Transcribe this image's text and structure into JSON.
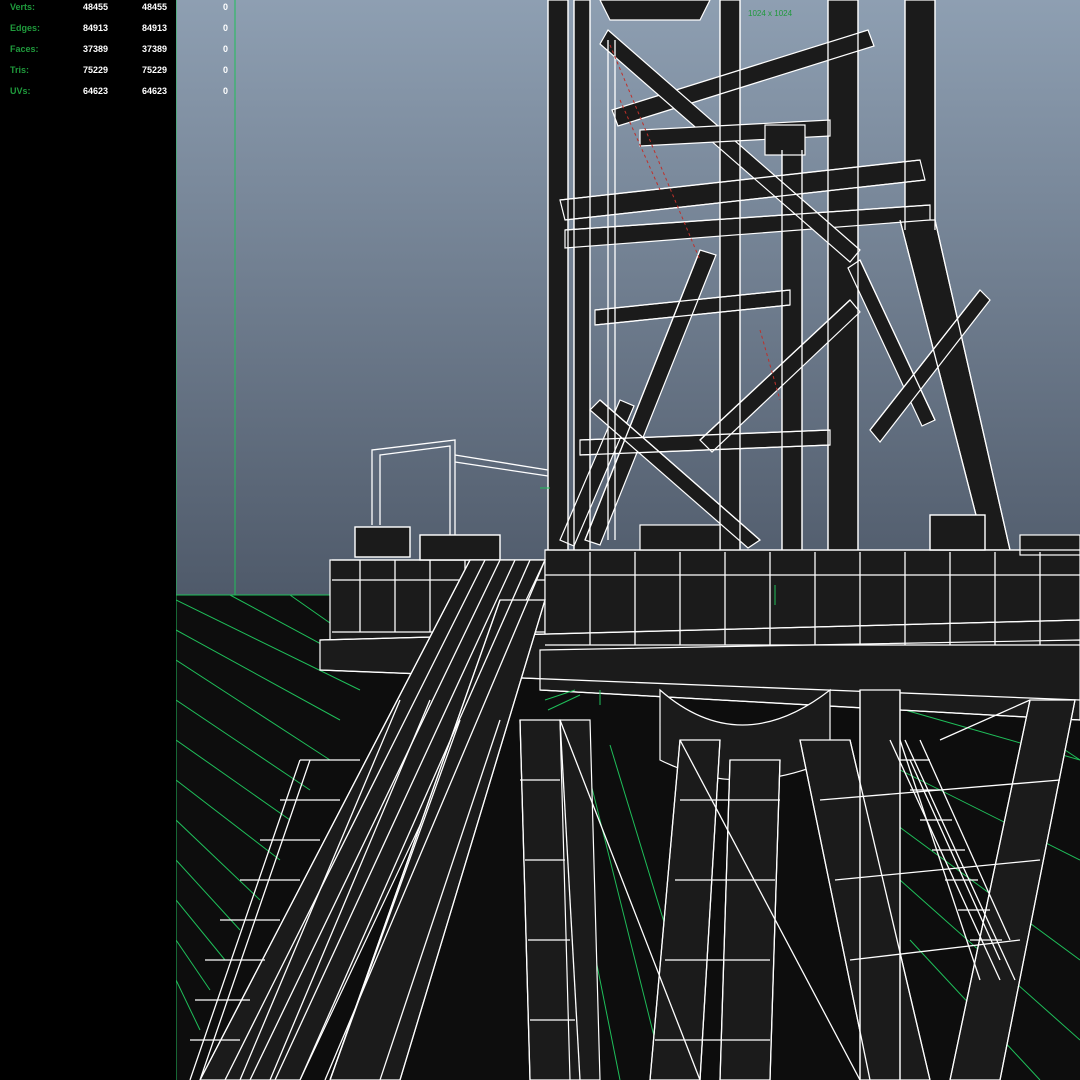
{
  "stats": {
    "rows": [
      {
        "label": "Verts:",
        "value": "48455",
        "selected": "48455",
        "component": "0"
      },
      {
        "label": "Edges:",
        "value": "84913",
        "selected": "84913",
        "component": "0"
      },
      {
        "label": "Faces:",
        "value": "37389",
        "selected": "37389",
        "component": "0"
      },
      {
        "label": "Tris:",
        "value": "75229",
        "selected": "75229",
        "component": "0"
      },
      {
        "label": "UVs:",
        "value": "64623",
        "selected": "64623",
        "component": "0"
      }
    ]
  },
  "viewport": {
    "resolution_gate": "1024 x 1024",
    "colors": {
      "sky_top": "#8e9fb2",
      "sky_bottom": "#4f5a6a",
      "ground": "#0d0d0d",
      "grid": "#1fbf5a",
      "wire": "#ffffff",
      "steel": "#1b1b1b",
      "hud_label": "#1f9a3c"
    }
  }
}
